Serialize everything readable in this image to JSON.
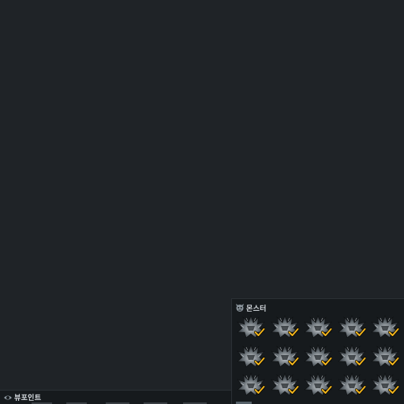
{
  "monster_panel": {
    "title": "몬스터",
    "icon": "monster-head-icon",
    "rows": 3,
    "columns": 5,
    "cells": [
      {
        "icon": "spiky-monster-icon",
        "checked": true
      },
      {
        "icon": "spiky-monster-icon",
        "checked": true
      },
      {
        "icon": "spiky-monster-icon",
        "checked": true
      },
      {
        "icon": "spiky-monster-icon",
        "checked": true
      },
      {
        "icon": "spiky-monster-icon",
        "checked": true
      },
      {
        "icon": "spiky-monster-icon",
        "checked": true
      },
      {
        "icon": "spiky-monster-icon",
        "checked": true
      },
      {
        "icon": "spiky-monster-icon",
        "checked": true
      },
      {
        "icon": "spiky-monster-icon",
        "checked": true
      },
      {
        "icon": "spiky-monster-icon",
        "checked": true
      },
      {
        "icon": "spiky-monster-icon",
        "checked": true
      },
      {
        "icon": "spiky-monster-icon",
        "checked": true
      },
      {
        "icon": "spiky-monster-icon",
        "checked": true
      },
      {
        "icon": "spiky-monster-icon",
        "checked": true
      },
      {
        "icon": "spiky-monster-icon",
        "checked": true
      }
    ],
    "check_color": "#f2b51c"
  },
  "viewpoint_panel": {
    "title": "뷰포인트",
    "icon": "eye-icon"
  },
  "colors": {
    "background": "#1f2327",
    "panel": "#161a1d",
    "title_text": "#d8dde2"
  }
}
